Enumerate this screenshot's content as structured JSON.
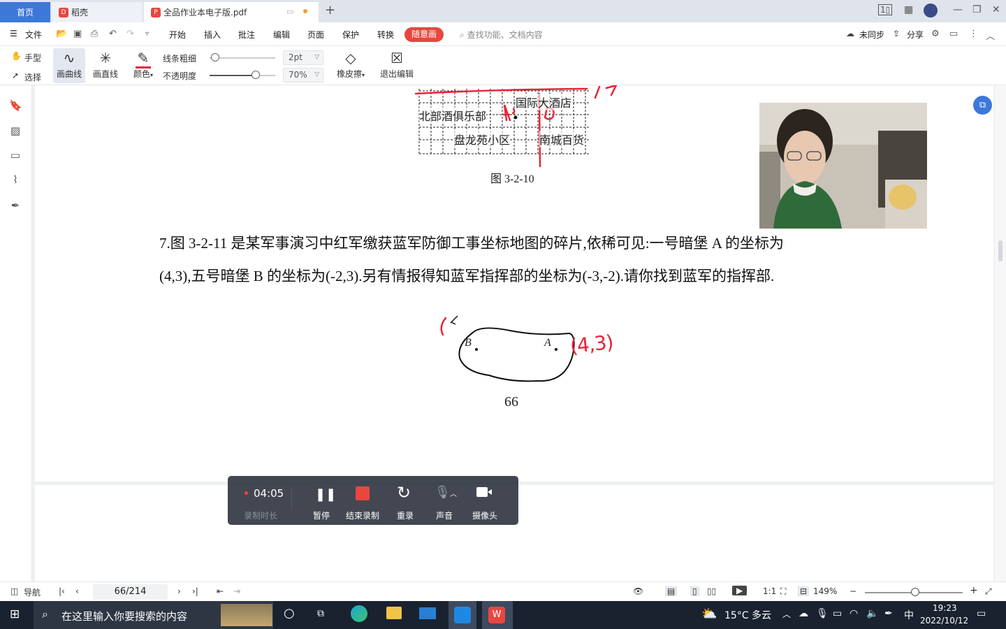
{
  "tabs": {
    "home": "首页",
    "daoke": "稻壳",
    "pdf": "全品作业本电子版.pdf"
  },
  "menubar": {
    "file": "文件",
    "items": [
      "开始",
      "插入",
      "批注",
      "编辑",
      "页面",
      "保护",
      "转换"
    ],
    "active_pill": "随意画",
    "search_placeholder": "查找功能、文档内容",
    "sync": "未同步",
    "share": "分享"
  },
  "ribbon": {
    "hand": "手型",
    "select": "选择",
    "curve": "画曲线",
    "line": "画直线",
    "color": "颜色",
    "line_width_label": "线条粗细",
    "opacity_label": "不透明度",
    "line_width_value": "2pt",
    "opacity_value": "70%",
    "opacity_level": 0.7,
    "eraser": "橡皮擦",
    "exit_edit": "退出编辑"
  },
  "document": {
    "map_labels": {
      "hotel": "国际大酒店",
      "club": "北部酒俱乐部",
      "residence": "盘龙苑小区",
      "mall": "南城百货"
    },
    "figure_caption": "图 3-2-10",
    "problem_line1": "7.图 3-2-11 是某军事演习中红军缴获蓝军防御工事坐标地图的碎片,依稀可见:一号暗堡 A 的坐标为",
    "problem_line2": "(4,3),五号暗堡 B 的坐标为(-2,3).另有情报得知蓝军指挥部的坐标为(-3,-2).请你找到蓝军的指挥部.",
    "fragment_label_b": "B",
    "fragment_label_a": "A",
    "handwritten_annotation": "(4,3)",
    "page_number": "66"
  },
  "recording": {
    "time": "04:05",
    "duration_label": "录制时长",
    "pause": "暂停",
    "stop": "结束录制",
    "rerecord": "重录",
    "sound": "声音",
    "camera": "摄像头"
  },
  "status": {
    "nav": "导航",
    "page": "66/214",
    "zoom": "149%"
  },
  "taskbar": {
    "search_placeholder": "在这里输入你要搜索的内容",
    "weather": "15°C 多云",
    "ime": "中",
    "time": "19:23",
    "date": "2022/10/12"
  },
  "colors": {
    "accent_blue": "#3d78d8",
    "annotation_red": "#e8243a",
    "pill_red": "#e8473f"
  }
}
